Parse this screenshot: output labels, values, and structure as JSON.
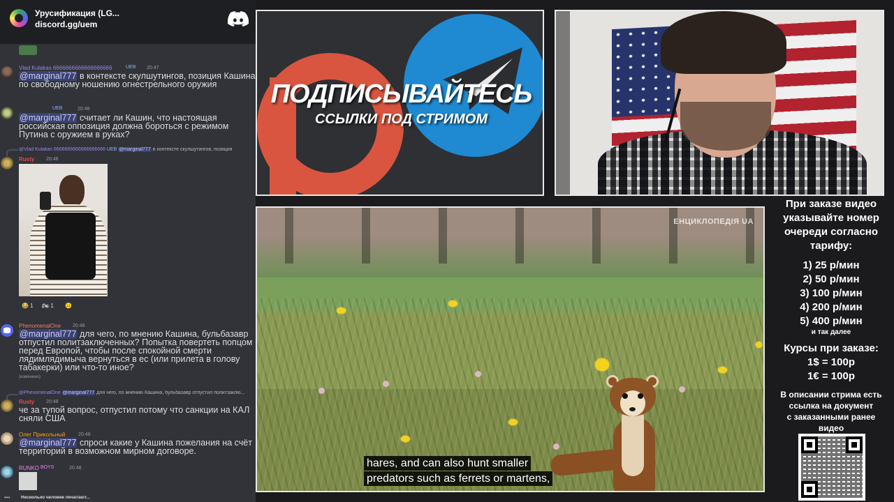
{
  "chat": {
    "server_name": "Урусификация (LG...",
    "server_invite": "discord.gg/uem",
    "messages": [
      {
        "user": "Vlad Kulakas 6666666666666666666",
        "badge": "UEB",
        "time": "20:47",
        "mention": "@marginal777",
        "text": " в контексте скулшутингов, позиция Кашина по свободному ношению огнестрельного оружия"
      },
      {
        "user": "",
        "badge": "UEB",
        "time": "20:48",
        "mention": "@marginal777",
        "text": " считает ли Кашин, что настоящая российская оппозиция должна бороться с режимом Путина с оружием в руках?"
      },
      {
        "reply_user": "@Vlad Kulakas 6666666666666666666",
        "reply_badge": "UEB",
        "reply_mention": "@marginal777",
        "reply_text": " в контексте скулшутингов, позиция",
        "user": "Rusty",
        "time": "20:48",
        "reactions": [
          "😂 1",
          "🏍 1",
          "😐"
        ]
      },
      {
        "user": "PhenomenalOne",
        "time": "20:48",
        "mention": "@marginal777",
        "text": " для чего, по мнению Кашина, бульбазавр отпустил политзаключенных? Попытка повертеть попцом перед Европой, чтобы после спокойной смерти лядимлядимыча вернуться в ес (или прилета в голову табакерки) или что-то иное?",
        "edited": "(изменено)"
      },
      {
        "reply_user": "@PhenomenalOne",
        "reply_mention": "@marginal777",
        "reply_text": " для чего, по мнению Кашина, бульбазавр отпустил политзаклю...",
        "user": "Rusty",
        "time": "20:48",
        "text": "че за тупой вопрос, отпустил потому что санкции на КАЛ сняли США"
      },
      {
        "user": "Олег Прикольный",
        "time": "20:48",
        "mention": "@marginal777",
        "text": " спроси какие у Кашина пожелания на счёт территорий в возможном мирном договоре."
      },
      {
        "user": "RUNKO",
        "badge": "BOYS",
        "time": "20:48"
      }
    ],
    "typing": "Несколько человек печатают..."
  },
  "banner": {
    "title": "ПОДПИСЫВАЙТЕСЬ",
    "subtitle": "ССЫЛКИ ПОД СТРИМОМ"
  },
  "video": {
    "watermark": "ЕНЦИКЛОПЕДІЯ UA",
    "subtitle_line1": "hares, and can also hunt smaller",
    "subtitle_line2": "predators such as ferrets or martens,"
  },
  "info": {
    "order_lines": [
      "При заказе видео",
      "указывайте номер",
      "очереди согласно",
      "тарифу:"
    ],
    "tariffs": [
      "1) 25 р/мин",
      "2) 50 р/мин",
      "3) 100 р/мин",
      "4) 200 р/мин",
      "5) 400 р/мин"
    ],
    "and_so_on": "и так далее",
    "rates_title": "Курсы при заказе:",
    "rates": [
      "1$ = 100р",
      "1€ = 100р"
    ],
    "description_lines": [
      "В описании стрима есть",
      "ссылка на документ",
      "с заказанными ранее",
      "видео"
    ]
  },
  "colors": {
    "chat_bg": "#313338",
    "mention_bg": "#3c4270",
    "discord_blurple": "#5865f2",
    "patreon": "#d9553f",
    "telegram": "#1f8ad1"
  }
}
